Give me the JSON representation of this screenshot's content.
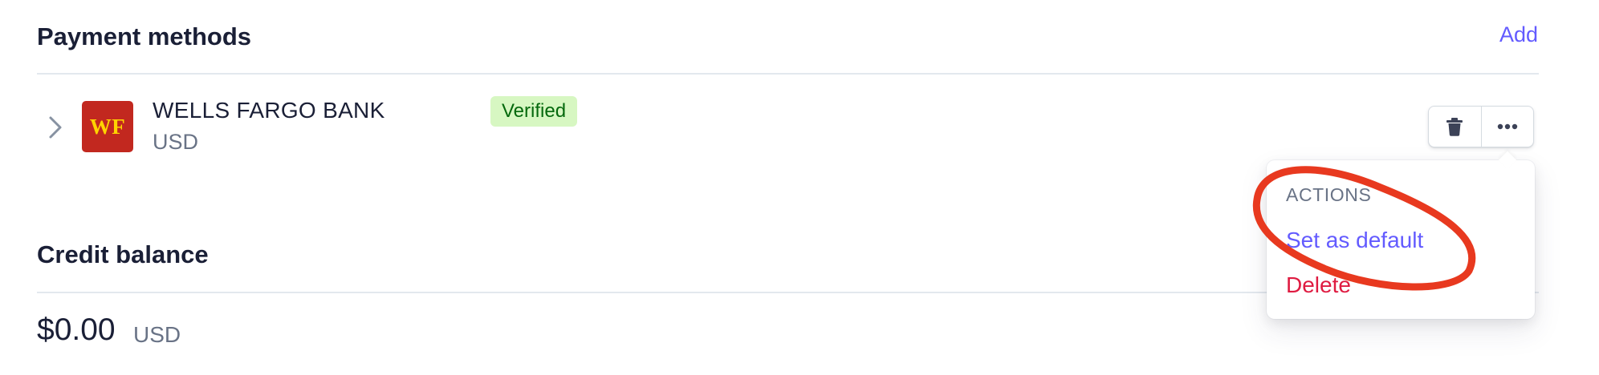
{
  "payment_methods": {
    "title": "Payment methods",
    "add_label": "Add",
    "items": [
      {
        "bank_name": "WELLS FARGO BANK",
        "currency": "USD",
        "logo_text": "WF",
        "status": "Verified"
      }
    ]
  },
  "credit_balance": {
    "title": "Credit balance",
    "amount": "$0.00",
    "currency": "USD"
  },
  "actions_menu": {
    "heading": "ACTIONS",
    "items": [
      {
        "label": "Set as default",
        "tone": "primary"
      },
      {
        "label": "Delete",
        "tone": "danger"
      }
    ]
  },
  "icons": {
    "expand": "chevron-right-icon",
    "delete": "trash-icon",
    "more": "more-horizontal-icon"
  },
  "colors": {
    "accent": "#635bff",
    "danger": "#df1b41",
    "verified_bg": "#d7f7c2",
    "verified_text": "#05690d",
    "bank_logo_bg": "#c2281f",
    "bank_logo_text": "#ffd400",
    "annotation": "#e8391f"
  }
}
